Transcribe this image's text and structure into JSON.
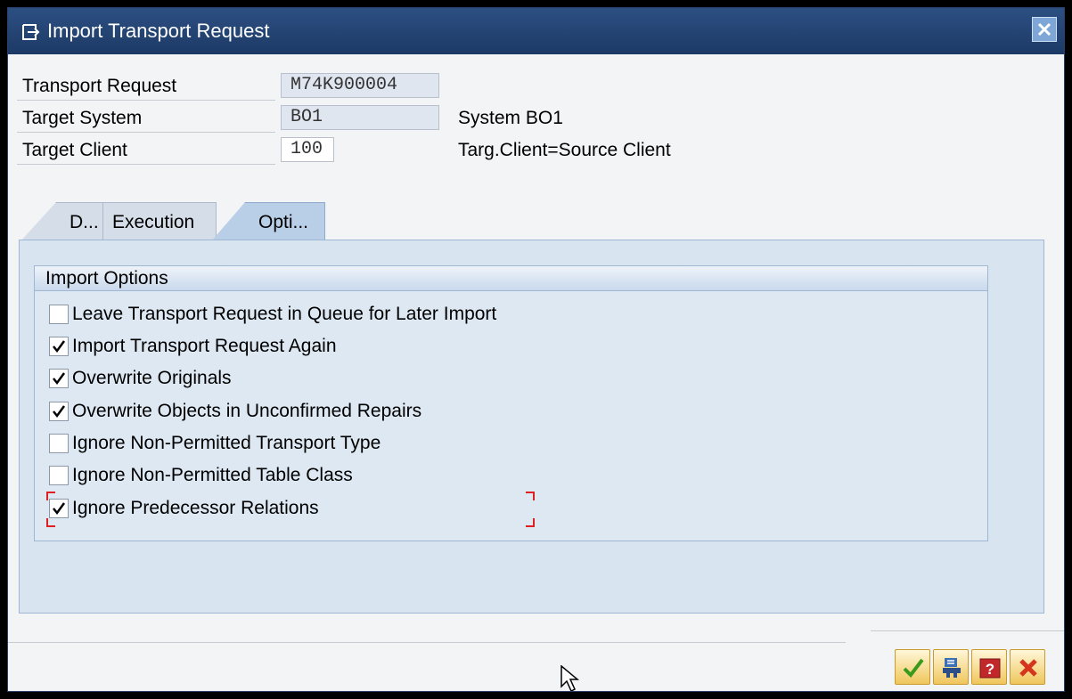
{
  "window": {
    "title": "Import Transport Request"
  },
  "fields": [
    {
      "label": "Transport Request",
      "value": "M74K900004",
      "description": ""
    },
    {
      "label": "Target System",
      "value": "BO1",
      "description": "System BO1"
    },
    {
      "label": "Target Client",
      "value": "100",
      "description": "Targ.Client=Source Client"
    }
  ],
  "tabs": [
    {
      "label": "D..."
    },
    {
      "label": "Execution"
    },
    {
      "label": "Opti..."
    }
  ],
  "import_options": {
    "title": "Import Options",
    "items": [
      {
        "label": "Leave Transport Request in Queue for Later Import",
        "checked": false
      },
      {
        "label": "Import Transport Request Again",
        "checked": true
      },
      {
        "label": "Overwrite Originals",
        "checked": true
      },
      {
        "label": "Overwrite Objects in Unconfirmed Repairs",
        "checked": true
      },
      {
        "label": "Ignore Non-Permitted Transport Type",
        "checked": false
      },
      {
        "label": "Ignore Non-Permitted Table Class",
        "checked": false
      },
      {
        "label": "Ignore Predecessor Relations",
        "checked": true
      }
    ]
  },
  "footer_buttons": [
    {
      "icon": "checkmark-icon"
    },
    {
      "icon": "transport-icon"
    },
    {
      "icon": "help-icon"
    },
    {
      "icon": "cancel-icon"
    }
  ]
}
